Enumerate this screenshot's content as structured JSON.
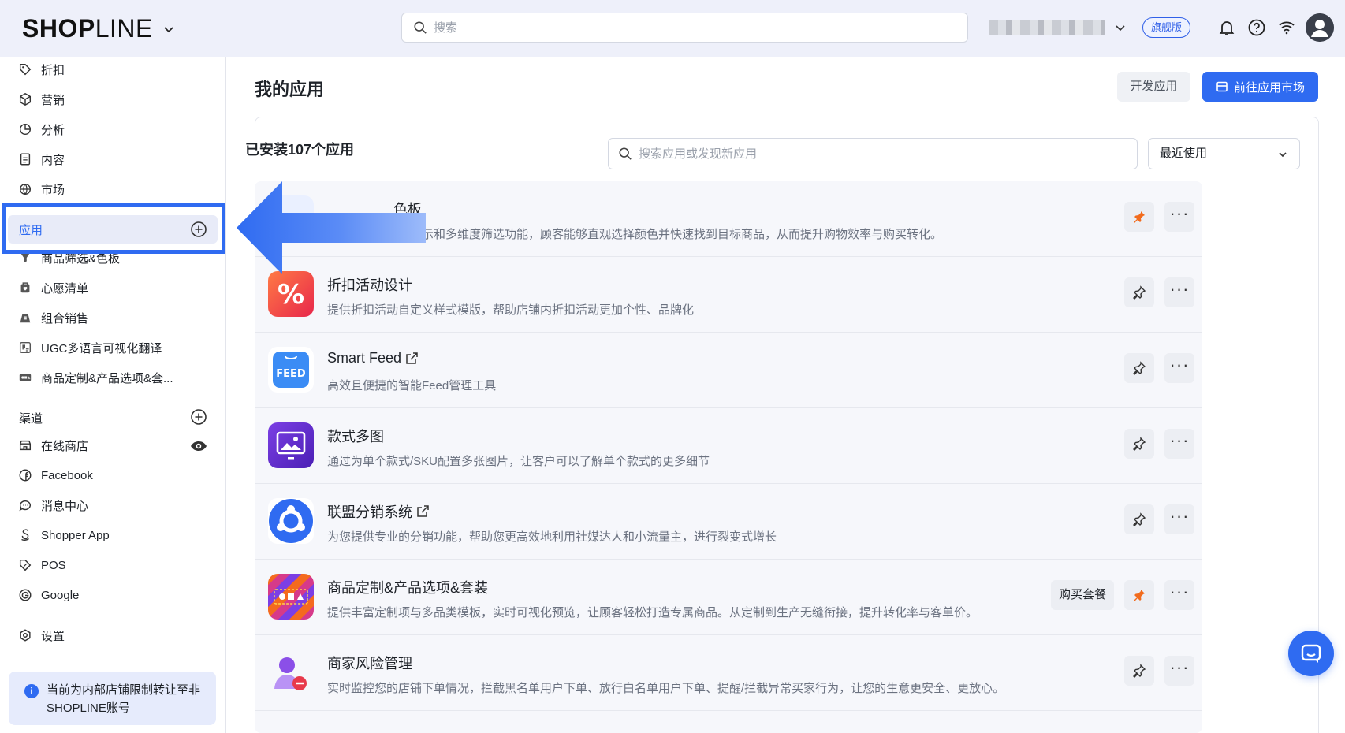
{
  "brand": {
    "logo_bold": "SHOP",
    "logo_light": "LINE"
  },
  "header": {
    "search_placeholder": "搜索",
    "plan_badge": "旗舰版"
  },
  "sidebar": {
    "top_items": [
      {
        "label": "折扣",
        "icon": "tag-icon"
      },
      {
        "label": "营销",
        "icon": "cube-icon"
      },
      {
        "label": "分析",
        "icon": "pie-chart-icon"
      },
      {
        "label": "内容",
        "icon": "document-icon"
      },
      {
        "label": "市场",
        "icon": "globe-icon"
      }
    ],
    "apps_label": "应用",
    "app_items": [
      {
        "label": "商品筛选&色板"
      },
      {
        "label": "心愿清单"
      },
      {
        "label": "组合销售"
      },
      {
        "label": "UGC多语言可视化翻译"
      },
      {
        "label": "商品定制&产品选项&套..."
      }
    ],
    "channels_label": "渠道",
    "channel_items": [
      {
        "label": "在线商店",
        "icon": "store-icon"
      },
      {
        "label": "Facebook",
        "icon": "facebook-icon"
      },
      {
        "label": "消息中心",
        "icon": "chat-icon"
      },
      {
        "label": "Shopper App",
        "icon": "shopper-app-icon"
      },
      {
        "label": "POS",
        "icon": "pos-tag-icon"
      },
      {
        "label": "Google",
        "icon": "google-icon"
      }
    ],
    "settings_label": "设置",
    "notice": "当前为内部店铺限制转让至非SHOPLINE账号"
  },
  "main": {
    "title": "我的应用",
    "dev_button": "开发应用",
    "market_button": "前往应用市场",
    "installed_label": "已安装107个应用",
    "search_placeholder": "搜索应用或发现新应用",
    "sort_value": "最近使用",
    "apps": [
      {
        "name": "商品筛选&色板",
        "name_visible": "色板",
        "desc": "通过可视化色板展示和多维度筛选功能，顾客能够直观选择颜色并快速找到目标商品，从而提升购物效率与购买转化。",
        "pinned": true,
        "external": false
      },
      {
        "name": "折扣活动设计",
        "desc": "提供折扣活动自定义样式模版，帮助店铺内折扣活动更加个性、品牌化",
        "pinned": false,
        "external": false
      },
      {
        "name": "Smart Feed",
        "desc": "高效且便捷的智能Feed管理工具",
        "pinned": false,
        "external": true
      },
      {
        "name": "款式多图",
        "desc": "通过为单个款式/SKU配置多张图片，让客户可以了解单个款式的更多细节",
        "pinned": false,
        "external": false
      },
      {
        "name": "联盟分销系统",
        "desc": "为您提供专业的分销功能，帮助您更高效地利用社媒达人和小流量主，进行裂变式增长",
        "pinned": false,
        "external": true
      },
      {
        "name": "商品定制&产品选项&套装",
        "desc": "提供丰富定制项与多品类模板，实时可视化预览，让顾客轻松打造专属商品。从定制到生产无缝衔接，提升转化率与客单价。",
        "pinned": true,
        "external": false,
        "buy_label": "购买套餐"
      },
      {
        "name": "商家风险管理",
        "desc": "实时监控您的店铺下单情况，拦截黑名单用户下单、放行白名单用户下单、提醒/拦截异常买家行为，让您的生意更安全、更放心。",
        "pinned": false,
        "external": false
      }
    ],
    "feed_icon_text": "FEED"
  },
  "colors": {
    "accent": "#2f6bf1",
    "pin_active": "#f26b1d",
    "sidebar_active": "#e8ebf8"
  }
}
